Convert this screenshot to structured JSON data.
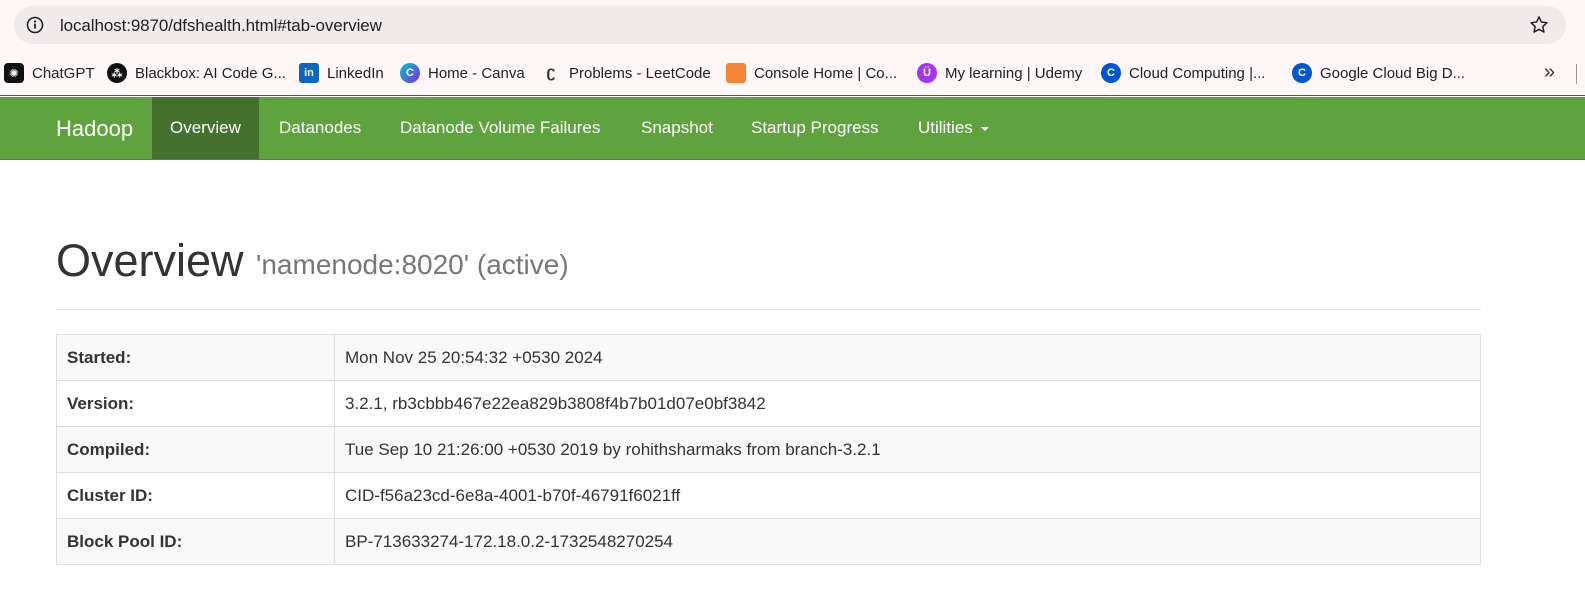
{
  "browser": {
    "url": "localhost:9870/dfshealth.html#tab-overview",
    "bookmarks": [
      {
        "label": "ChatGPT",
        "icon": "chatgpt-icon",
        "color": "#111111"
      },
      {
        "label": "Blackbox: AI Code G...",
        "icon": "blackbox-icon",
        "color": "#111111"
      },
      {
        "label": "LinkedIn",
        "icon": "linkedin-icon",
        "color": "#0a66c2"
      },
      {
        "label": "Home - Canva",
        "icon": "canva-icon",
        "color": "#7d2ae8"
      },
      {
        "label": "Problems - LeetCode",
        "icon": "leetcode-icon",
        "color": "#ffa116"
      },
      {
        "label": "Console Home | Co...",
        "icon": "aws-cube-icon",
        "color": "#f58536"
      },
      {
        "label": "My learning | Udemy",
        "icon": "udemy-icon",
        "color": "#a435f0"
      },
      {
        "label": "Cloud Computing |...",
        "icon": "coursera-icon",
        "color": "#0056d2"
      },
      {
        "label": "Google Cloud Big D...",
        "icon": "coursera-icon",
        "color": "#0056d2"
      }
    ],
    "more": "»"
  },
  "navbar": {
    "brand": "Hadoop",
    "items": [
      {
        "label": "Overview",
        "active": true
      },
      {
        "label": "Datanodes"
      },
      {
        "label": "Datanode Volume Failures"
      },
      {
        "label": "Snapshot"
      },
      {
        "label": "Startup Progress"
      },
      {
        "label": "Utilities",
        "dropdown": true
      }
    ],
    "color": "#5fa33e",
    "active_color": "#44722e"
  },
  "overview": {
    "title": "Overview",
    "subtitle": "'namenode:8020' (active)",
    "rows": [
      {
        "key": "Started:",
        "value": "Mon Nov 25 20:54:32 +0530 2024"
      },
      {
        "key": "Version:",
        "value": "3.2.1, rb3cbbb467e22ea829b3808f4b7b01d07e0bf3842"
      },
      {
        "key": "Compiled:",
        "value": "Tue Sep 10 21:26:00 +0530 2019 by rohithsharmaks from branch-3.2.1"
      },
      {
        "key": "Cluster ID:",
        "value": "CID-f56a23cd-6e8a-4001-b70f-46791f6021ff"
      },
      {
        "key": "Block Pool ID:",
        "value": "BP-713633274-172.18.0.2-1732548270254"
      }
    ]
  }
}
